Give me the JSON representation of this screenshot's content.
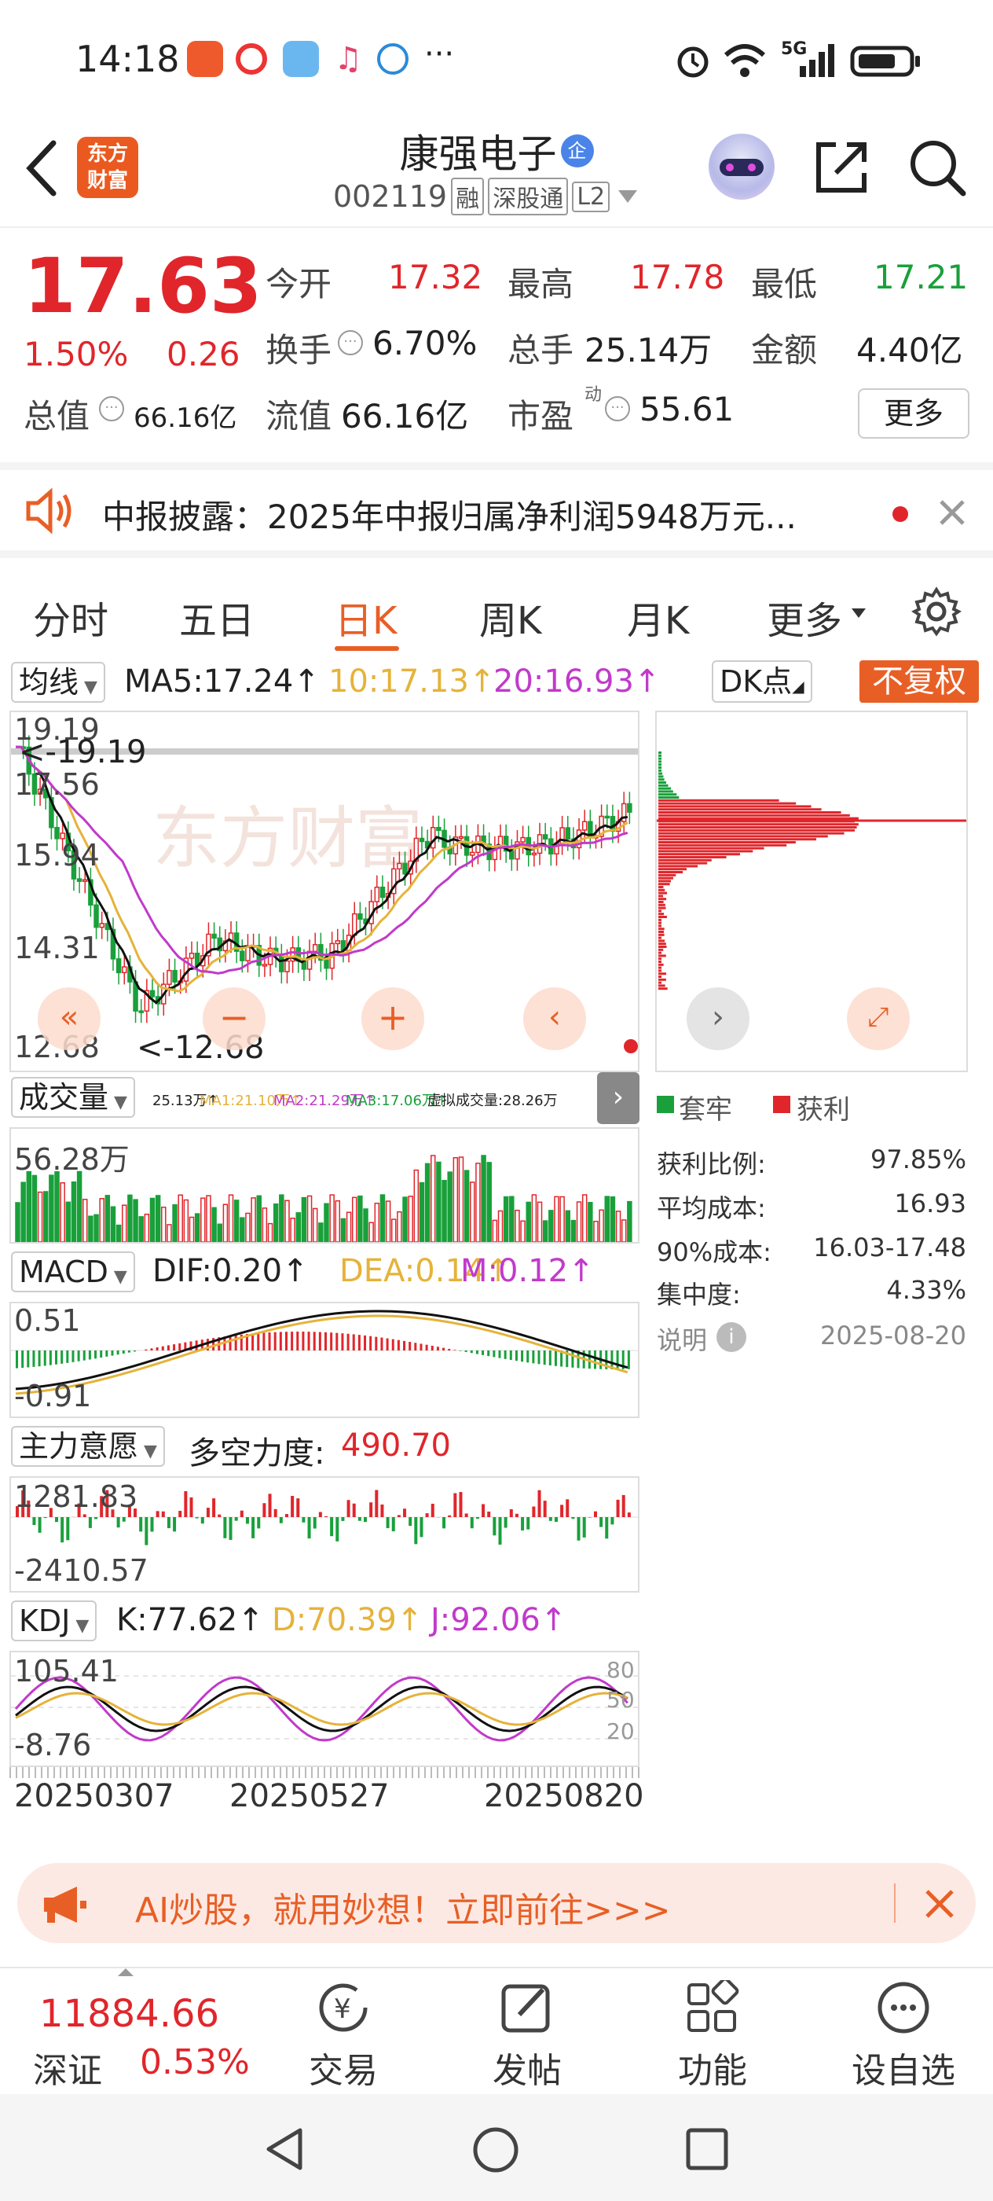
{
  "status_bar": {
    "time": "14:18",
    "more": "···",
    "network": "5G"
  },
  "header": {
    "back_icon": "chevron-left-icon",
    "brand_logo_line1": "东方",
    "brand_logo_line2": "财富",
    "stock_name": "康强电子",
    "enterprise_badge": "企",
    "stock_code": "002119",
    "tags": [
      "融",
      "深股通",
      "L2"
    ]
  },
  "quote": {
    "price": "17.63",
    "change_pct": "1.50%",
    "change_abs": "0.26",
    "open_label": "今开",
    "open_value": "17.32",
    "high_label": "最高",
    "high_value": "17.78",
    "low_label": "最低",
    "low_value": "17.21",
    "turnover_label": "换手",
    "turnover_value": "6.70%",
    "volume_label": "总手",
    "volume_value": "25.14万",
    "amount_label": "金额",
    "amount_value": "4.40亿",
    "mktcap_label": "总值",
    "mktcap_value": "66.16亿",
    "float_label": "流值",
    "float_value": "66.16亿",
    "pe_label": "市盈",
    "pe_sup": "动",
    "pe_value": "55.61",
    "more_button": "更多"
  },
  "notice": {
    "text": "中报披露：2025年中报归属净利润5948万元..."
  },
  "tabs": [
    "分时",
    "五日",
    "日K",
    "周K",
    "月K",
    "更多"
  ],
  "active_tab": "日K",
  "kline": {
    "ma_selector": "均线",
    "ma5": "MA5:17.24↑",
    "ma10": "10:17.13↑",
    "ma20": "20:16.93↑",
    "dk_button": "DK点",
    "fq_button": "不复权",
    "y_labels": [
      "19.19",
      "17.56",
      "15.94",
      "14.31",
      "12.68"
    ],
    "max_marker": "<-19.19",
    "min_marker": "<-12.68",
    "watermark": "东方财富"
  },
  "volume": {
    "selector": "成交量",
    "info": "25.13万↑",
    "ma1": "MA1:21.10万↑",
    "ma2": "MA2:21.29万↑",
    "ma3": "MA3:17.06万↑",
    "virtual": "虚拟成交量:28.26万",
    "y_label": "56.28万"
  },
  "macd": {
    "selector": "MACD",
    "dif": "DIF:0.20↑",
    "dea": "DEA:0.14↑",
    "m": "M:0.12↑",
    "y_top": "0.51",
    "y_bottom": "-0.91"
  },
  "main_force": {
    "selector": "主力意愿",
    "power_label": "多空力度:",
    "power_value": "490.70",
    "y_top": "1281.83",
    "y_bottom": "-2410.57"
  },
  "kdj": {
    "selector": "KDJ",
    "k": "K:77.62↑",
    "d": "D:70.39↑",
    "j": "J:92.06↑",
    "y_top": "105.41",
    "y_bottom": "-8.76",
    "levels": [
      "80",
      "50",
      "20"
    ]
  },
  "dates": [
    "20250307",
    "20250527",
    "20250820"
  ],
  "chips": {
    "legend_trapped": "套牢",
    "legend_profit": "获利",
    "rows": [
      {
        "label": "获利比例:",
        "value": "97.85%"
      },
      {
        "label": "平均成本:",
        "value": "16.93"
      },
      {
        "label": "90%成本:",
        "value": "16.03-17.48"
      },
      {
        "label": "集中度:",
        "value": "4.33%"
      }
    ],
    "note_label": "说明",
    "date": "2025-08-20"
  },
  "banner": {
    "text": "AI炒股，就用妙想！立即前往>>>"
  },
  "bottom_nav": {
    "index_value": "11884.66",
    "index_name": "深证",
    "index_change": "0.53%",
    "items": [
      "交易",
      "发帖",
      "功能",
      "设自选"
    ]
  },
  "colors": {
    "up": "#e0262b",
    "down": "#19a03b",
    "ma10": "#e5b33a",
    "ma20": "#c13acb",
    "accent": "#e85f26"
  }
}
